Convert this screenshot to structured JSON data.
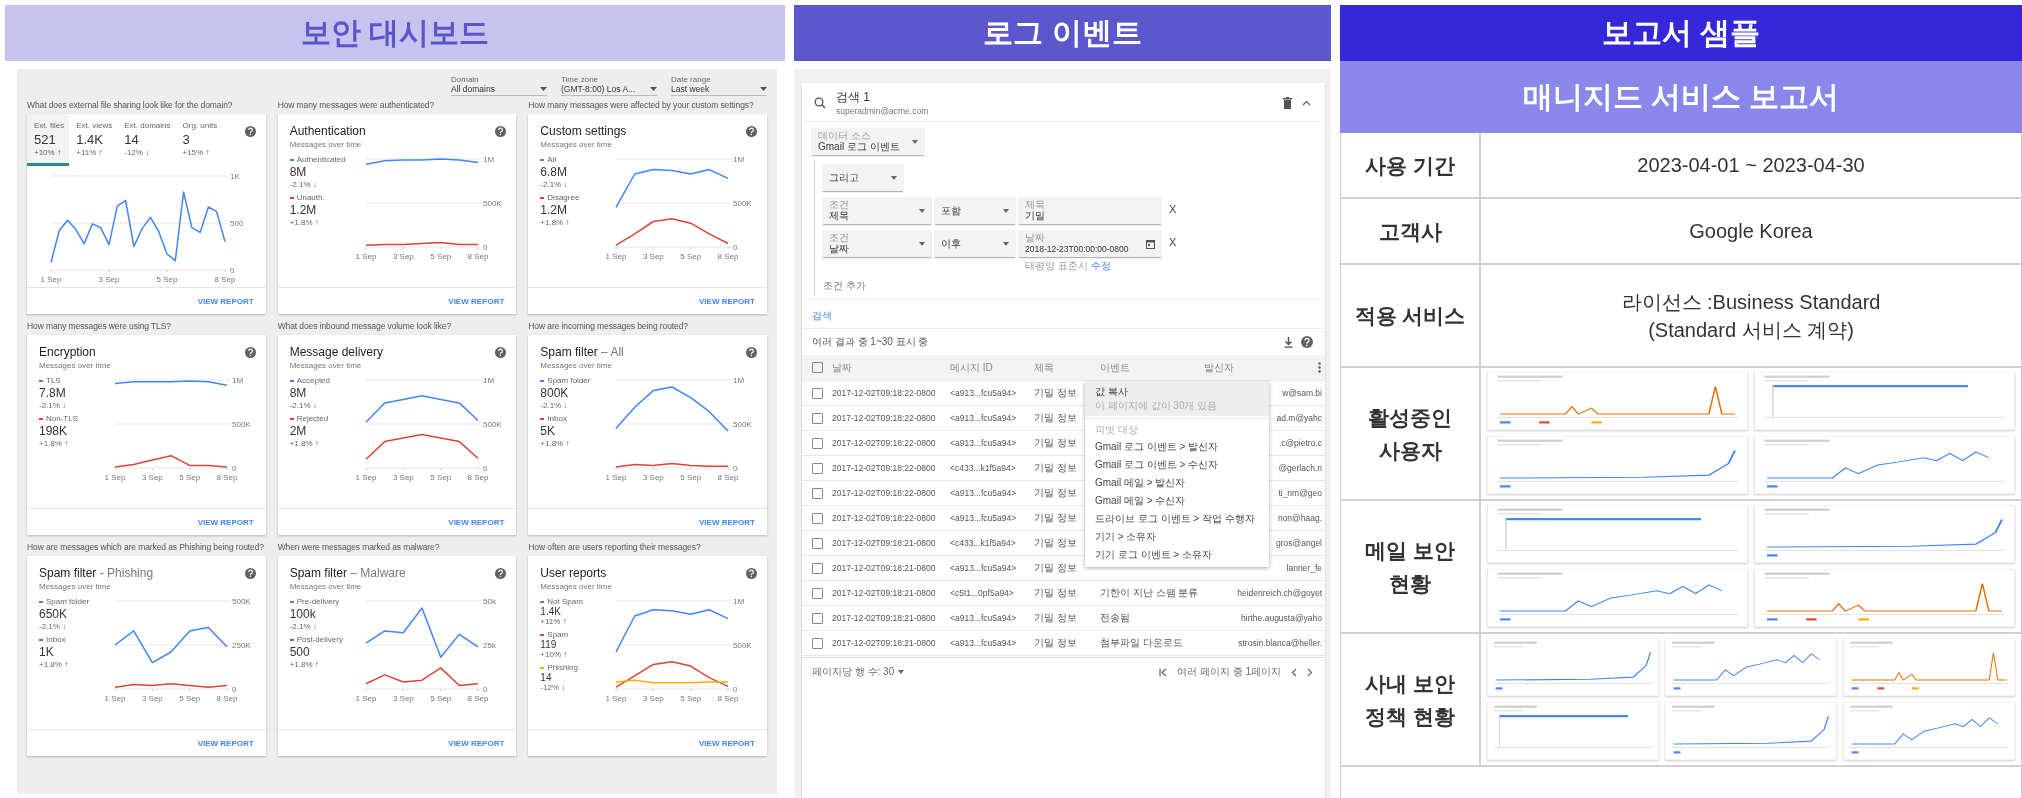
{
  "dashboard": {
    "title": "보안 대시보드",
    "filters": [
      {
        "label": "Domain",
        "value": "All domains"
      },
      {
        "label": "Time zone",
        "value": "(GMT-8:00) Los A..."
      },
      {
        "label": "Date range",
        "value": "Last week"
      }
    ],
    "cards": [
      {
        "question": "What does external file sharing look like for the domain?",
        "kind": "tabs",
        "tabs": [
          {
            "label": "Ext. files",
            "value": "521",
            "change": "+10% ↑",
            "selected": true
          },
          {
            "label": "Ext. views",
            "value": "1.4K",
            "change": "+11% ↑",
            "selected": false
          },
          {
            "label": "Ext. domains",
            "value": "14",
            "change": "-12% ↓",
            "selected": false
          },
          {
            "label": "Org. units",
            "value": "3",
            "change": "+15% ↑",
            "selected": false
          }
        ],
        "chart_data": {
          "type": "line",
          "categories": [
            "1 Sep",
            null,
            null,
            null,
            null,
            null,
            null,
            "3 Sep",
            null,
            null,
            null,
            null,
            null,
            null,
            "5 Sep",
            null,
            null,
            null,
            null,
            null,
            null,
            "8 Sep"
          ],
          "yticks": [
            {
              "value": 0,
              "label": "0"
            },
            {
              "value": 500,
              "label": "500"
            },
            {
              "value": 1000,
              "label": "1K"
            }
          ],
          "ylim": [
            0,
            1000
          ],
          "series": [
            {
              "color": "#4285f4",
              "values": [
                80,
                420,
                530,
                430,
                280,
                490,
                450,
                270,
                680,
                740,
                250,
                440,
                560,
                410,
                170,
                100,
                830,
                450,
                400,
                670,
                620,
                300
              ]
            }
          ]
        },
        "link": "VIEW REPORT"
      },
      {
        "question": "How many messages were authenticated?",
        "kind": "legend",
        "title": "Authentication",
        "subtitle": "Messages over time",
        "legend": [
          {
            "value": "8M",
            "change": "-2.1% ↓"
          },
          {
            "value": "1.2M",
            "change": "+1.8% ↑"
          }
        ],
        "chart_data": {
          "type": "line",
          "categories": [
            "1 Sep",
            null,
            "3 Sep",
            null,
            "5 Sep",
            null,
            "8 Sep"
          ],
          "yticks": [
            {
              "value": 0,
              "label": "0"
            },
            {
              "value": 500000,
              "label": "500K"
            },
            {
              "value": 1000000,
              "label": "1M"
            }
          ],
          "ylim": [
            0,
            1000000
          ],
          "series": [
            {
              "name": "Authenticated",
              "color": "#4285f4",
              "values": [
                940000,
                980000,
                990000,
                990000,
                1000000,
                990000,
                960000
              ]
            },
            {
              "name": "Unauth.",
              "color": "#db4437",
              "values": [
                20000,
                30000,
                30000,
                40000,
                50000,
                30000,
                30000
              ]
            }
          ]
        },
        "link": "VIEW REPORT"
      },
      {
        "question": "How many messages were affected by your custom settings?",
        "kind": "legend",
        "title": "Custom settings",
        "subtitle": "Messages over time",
        "legend": [
          {
            "value": "6.8M",
            "change": "-2.1% ↓"
          },
          {
            "value": "1.2M",
            "change": "+1.8% ↑"
          }
        ],
        "chart_data": {
          "type": "line",
          "categories": [
            "1 Sep",
            null,
            "3 Sep",
            null,
            "5 Sep",
            null,
            "8 Sep"
          ],
          "yticks": [
            {
              "value": 0,
              "label": "0"
            },
            {
              "value": 500000,
              "label": "500K"
            },
            {
              "value": 1000000,
              "label": "1M"
            }
          ],
          "ylim": [
            0,
            1000000
          ],
          "series": [
            {
              "name": "All",
              "color": "#4285f4",
              "values": [
                450000,
                830000,
                880000,
                870000,
                830000,
                880000,
                780000
              ]
            },
            {
              "name": "Disagree",
              "color": "#db4437",
              "values": [
                20000,
                150000,
                290000,
                320000,
                270000,
                150000,
                40000
              ]
            }
          ]
        },
        "link": "VIEW REPORT"
      },
      {
        "question": "How many messages were using TLS?",
        "kind": "legend",
        "title": "Encryption",
        "subtitle": "Messages over time",
        "legend": [
          {
            "value": "7.8M",
            "change": "-2.1% ↓"
          },
          {
            "value": "198K",
            "change": "+1.8% ↑"
          }
        ],
        "chart_data": {
          "type": "line",
          "categories": [
            "1 Sep",
            null,
            "3 Sep",
            null,
            "5 Sep",
            null,
            "8 Sep"
          ],
          "yticks": [
            {
              "value": 0,
              "label": "0"
            },
            {
              "value": 500000,
              "label": "500K"
            },
            {
              "value": 1000000,
              "label": "1M"
            }
          ],
          "ylim": [
            0,
            1000000
          ],
          "series": [
            {
              "name": "TLS",
              "color": "#4285f4",
              "values": [
                960000,
                980000,
                980000,
                980000,
                990000,
                980000,
                940000
              ]
            },
            {
              "name": "Non-TLS",
              "color": "#db4437",
              "values": [
                10000,
                40000,
                90000,
                140000,
                30000,
                30000,
                10000
              ]
            }
          ]
        },
        "link": "VIEW REPORT"
      },
      {
        "question": "What does inbound message volume look like?",
        "kind": "legend",
        "title": "Message delivery",
        "subtitle": "Messages over time",
        "legend": [
          {
            "value": "8M",
            "change": "-2.1% ↓"
          },
          {
            "value": "2M",
            "change": "+1.8% ↑"
          }
        ],
        "chart_data": {
          "type": "line",
          "categories": [
            "1 Sep",
            null,
            "3 Sep",
            null,
            "5 Sep",
            null,
            "8 Sep"
          ],
          "yticks": [
            {
              "value": 0,
              "label": "0"
            },
            {
              "value": 500000,
              "label": "500K"
            },
            {
              "value": 1000000,
              "label": "1M"
            }
          ],
          "ylim": [
            0,
            1000000
          ],
          "series": [
            {
              "name": "Accepted",
              "color": "#4285f4",
              "values": [
                520000,
                740000,
                780000,
                820000,
                780000,
                740000,
                540000
              ]
            },
            {
              "name": "Rejected",
              "color": "#db4437",
              "values": [
                100000,
                300000,
                340000,
                380000,
                340000,
                300000,
                110000
              ]
            }
          ]
        },
        "link": "VIEW REPORT"
      },
      {
        "question": "How are incoming messages being routed?",
        "kind": "legend",
        "title": "Spam filter",
        "qualifier": "– All",
        "subtitle": "Messages over time",
        "legend": [
          {
            "value": "800K",
            "change": "-2.1% ↓"
          },
          {
            "value": "5K",
            "change": "+1.8% ↑"
          }
        ],
        "chart_data": {
          "type": "line",
          "categories": [
            "1 Sep",
            null,
            "3 Sep",
            null,
            "5 Sep",
            null,
            "8 Sep"
          ],
          "yticks": [
            {
              "value": 0,
              "label": "0"
            },
            {
              "value": 500000,
              "label": "500K"
            },
            {
              "value": 1000000,
              "label": "1M"
            }
          ],
          "ylim": [
            0,
            1000000
          ],
          "series": [
            {
              "name": "Spam folder",
              "color": "#4285f4",
              "values": [
                450000,
                690000,
                880000,
                920000,
                800000,
                640000,
                420000
              ]
            },
            {
              "name": "Inbox",
              "color": "#db4437",
              "values": [
                10000,
                40000,
                30000,
                50000,
                30000,
                20000,
                20000
              ]
            }
          ]
        },
        "link": "VIEW REPORT"
      },
      {
        "question": "How are messages which are marked as Phishing being routed?",
        "kind": "legend",
        "title": "Spam filter",
        "qualifier": "- Phishing",
        "subtitle": "Messages over time",
        "legend": [
          {
            "value": "650K",
            "change": "-2.1% ↓"
          },
          {
            "value": "1K",
            "change": "+1.8% ↑"
          }
        ],
        "chart_data": {
          "type": "line",
          "categories": [
            "1 Sep",
            null,
            "3 Sep",
            null,
            "5 Sep",
            null,
            "8 Sep"
          ],
          "yticks": [
            {
              "value": 0,
              "label": "0"
            },
            {
              "value": 250000,
              "label": "250K"
            },
            {
              "value": 500000,
              "label": "500K"
            }
          ],
          "ylim": [
            0,
            500000
          ],
          "series": [
            {
              "name": "Spam folder",
              "color": "#4285f4",
              "values": [
                250000,
                330000,
                150000,
                210000,
                330000,
                350000,
                240000
              ]
            },
            {
              "name": "Inbox",
              "color": "#db4437",
              "values": [
                10000,
                25000,
                20000,
                30000,
                20000,
                10000,
                20000
              ]
            }
          ]
        },
        "link": "VIEW REPORT"
      },
      {
        "question": "When were messages marked as malware?",
        "kind": "legend",
        "title": "Spam filter",
        "qualifier": "– Malware",
        "subtitle": "Messages over time",
        "legend": [
          {
            "value": "100k",
            "change": "-2.1% ↓"
          },
          {
            "value": "500",
            "change": "+1.8% ↑"
          }
        ],
        "chart_data": {
          "type": "line",
          "categories": [
            "1 Sep",
            null,
            "3 Sep",
            null,
            "5 Sep",
            null,
            "8 Sep"
          ],
          "yticks": [
            {
              "value": 0,
              "label": "0"
            },
            {
              "value": 25000,
              "label": "25k"
            },
            {
              "value": 50000,
              "label": "50k"
            }
          ],
          "ylim": [
            0,
            50000
          ],
          "series": [
            {
              "name": "Pre-delivery",
              "color": "#4285f4",
              "values": [
                26000,
                33000,
                32000,
                46000,
                18000,
                31000,
                24000
              ]
            },
            {
              "name": "Post-delivery",
              "color": "#db4437",
              "values": [
                3000,
                8000,
                4000,
                5000,
                12000,
                2000,
                3000
              ]
            }
          ]
        },
        "link": "VIEW REPORT"
      },
      {
        "question": "How often are users reporting their messages?",
        "kind": "legend",
        "title": "User reports",
        "subtitle": "Messages over time",
        "legend": [
          {
            "value": "1.4K",
            "change": "+11% ↑"
          },
          {
            "value": "119",
            "change": "+10% ↑"
          },
          {
            "value": "14",
            "change": "-12% ↓"
          }
        ],
        "chart_data": {
          "type": "line",
          "categories": [
            "1 Sep",
            null,
            "3 Sep",
            null,
            "5 Sep",
            null,
            "8 Sep"
          ],
          "yticks": [
            {
              "value": 0,
              "label": "0"
            },
            {
              "value": 500000,
              "label": "500K"
            },
            {
              "value": 1000000,
              "label": "1M"
            }
          ],
          "ylim": [
            0,
            1000000
          ],
          "series": [
            {
              "name": "Not Spam",
              "color": "#4285f4",
              "values": [
                420000,
                830000,
                900000,
                890000,
                850000,
                900000,
                800000
              ]
            },
            {
              "name": "Spam",
              "color": "#db4437",
              "values": [
                20000,
                150000,
                280000,
                310000,
                260000,
                130000,
                30000
              ]
            },
            {
              "name": "Phishing",
              "color": "#f4b400",
              "values": [
                80000,
                100000,
                70000,
                70000,
                70000,
                80000,
                80000
              ]
            }
          ]
        },
        "link": "VIEW REPORT"
      }
    ]
  },
  "log": {
    "title": "로그 이벤트",
    "search_title": "검색 1",
    "user": "superadmin@acme.com",
    "data_source": {
      "label": "데이터 소스",
      "value": "Gmail 로그 이벤트"
    },
    "operator": "그리고",
    "conditions": [
      {
        "label": "조건",
        "value": "제목",
        "op": "포함",
        "field_label": "제목",
        "field_value": "기밀",
        "kind": "text",
        "remove": "X"
      },
      {
        "label": "조건",
        "value": "날짜",
        "op": "이후",
        "field_label": "날짜",
        "field_value": "2018-12-23T00:00:00-0800",
        "kind": "date",
        "hint": "태평양 표준시",
        "hint_link": "수정",
        "remove": "X"
      }
    ],
    "add_condition": "조건 추가",
    "search_link": "검색",
    "results": "여러 결과 중 1~30 표시 중",
    "select_all": false,
    "columns": [
      "날짜",
      "메시지 ID",
      "제목",
      "이벤트",
      "발신자"
    ],
    "rows": [
      {
        "date": "2017-12-02T09:18:22-0800",
        "id": "<a913...fcu5a94>",
        "subject": "기밀 정보",
        "sender": "w@sam.bi",
        "checked": false
      },
      {
        "date": "2017-12-02T09:18:22-0800",
        "id": "<a913...fcu5a94>",
        "subject": "기밀 정보",
        "sender": "ad.m@yahc",
        "checked": false
      },
      {
        "date": "2017-12-02T09:18:22-0800",
        "id": "<a913...fcu5a94>",
        "subject": "기밀 정보",
        "sender": ".c@pietro.c",
        "checked": false
      },
      {
        "date": "2017-12-02T09:18:22-0800",
        "id": "<c433...k1f5a94>",
        "subject": "기밀 정보",
        "sender": "@gerlach.n",
        "checked": false
      },
      {
        "date": "2017-12-02T09:18:22-0800",
        "id": "<a913...fcu5a94>",
        "subject": "기밀 정보",
        "sender": "ti_nm@geo",
        "checked": false
      },
      {
        "date": "2017-12-02T09:18:22-0800",
        "id": "<a913...fcu5a94>",
        "subject": "기밀 정보",
        "sender": "non@haag.",
        "checked": false
      },
      {
        "date": "2017-12-02T09:18:21-0800",
        "id": "<c433...k1f5a94>",
        "subject": "기밀 정보",
        "sender": "gros@angel",
        "checked": false
      },
      {
        "date": "2017-12-02T09:18:21-0800",
        "id": "<a913...fcu5a94>",
        "subject": "기밀 정보",
        "sender": "lanner_fe",
        "checked": false
      },
      {
        "date": "2017-12-02T09:18:21-0800",
        "id": "<c5t1...0pf5a94>",
        "subject": "기밀 정보",
        "event": "기한이 지난 스팸 분류",
        "sender": "heidenreich.ch@goyet",
        "checked": false
      },
      {
        "date": "2017-12-02T09:18:21-0800",
        "id": "<a913...fcu5a94>",
        "subject": "기밀 정보",
        "event": "전송됨",
        "sender": "hirthe.augusta@yaho",
        "checked": false
      },
      {
        "date": "2017-12-02T09:18:21-0800",
        "id": "<a913...fcu5a94>",
        "subject": "기밀 정보",
        "event": "첨부파일 다운로드",
        "sender": "strosin.blanca@heller.",
        "checked": false
      }
    ],
    "menu": {
      "title": "값 복사",
      "subtitle": "이 페이지에 값이 30개 있음",
      "selected": true,
      "section": "피벗 대상",
      "items": [
        {
          "label": "Gmail 로그 이벤트 > 발신자",
          "selected": false
        },
        {
          "label": "Gmail 로그 이벤트 > 수신자",
          "selected": false
        },
        {
          "label": "Gmail 메일 > 발신자",
          "selected": false
        },
        {
          "label": "Gmail 메일 > 수신자",
          "selected": false
        },
        {
          "label": "드라이브 로그 이벤트 > 작업 수행자",
          "selected": false
        },
        {
          "label": "기기 > 소유자",
          "selected": false
        },
        {
          "label": "기기 로그 이벤트 > 소유자",
          "selected": false
        }
      ]
    },
    "rows_per_page": "페이지당 행 수: 30",
    "page": "여러 페이지 중 1페이지"
  },
  "report": {
    "title": "보고서 샘플",
    "subtitle": "매니지드 서비스 보고서",
    "rows": [
      {
        "label": [
          "사용 기간"
        ],
        "kind": "text",
        "lines": [
          "2023-04-01  ~ 2023-04-30"
        ]
      },
      {
        "label": [
          "고객사"
        ],
        "kind": "text",
        "lines": [
          "Google Korea"
        ]
      },
      {
        "label": [
          "적용 서비스"
        ],
        "kind": "text",
        "lines": [
          "라이선스 :Business Standard",
          "(Standard 서비스 계약)"
        ]
      },
      {
        "label": [
          "활성중인",
          "사용자"
        ],
        "kind": "thumbnails",
        "thumbnails": [
          {
            "kind": "picture"
          },
          {
            "kind": "picture"
          },
          {
            "kind": "picture"
          },
          {
            "kind": "picture"
          }
        ]
      },
      {
        "label": [
          "메일 보안",
          "현황"
        ],
        "kind": "thumbnails",
        "thumbnails": [
          {
            "kind": "picture"
          },
          {
            "kind": "picture"
          },
          {
            "kind": "picture"
          },
          {
            "kind": "picture"
          }
        ]
      },
      {
        "label": [
          "사내 보안",
          "정책 현황"
        ],
        "kind": "thumbnails",
        "thumbnails": [
          {
            "kind": "picture"
          },
          {
            "kind": "picture"
          },
          {
            "kind": "picture"
          },
          {
            "kind": "picture"
          },
          {
            "kind": "picture"
          },
          {
            "kind": "picture"
          }
        ]
      }
    ]
  }
}
